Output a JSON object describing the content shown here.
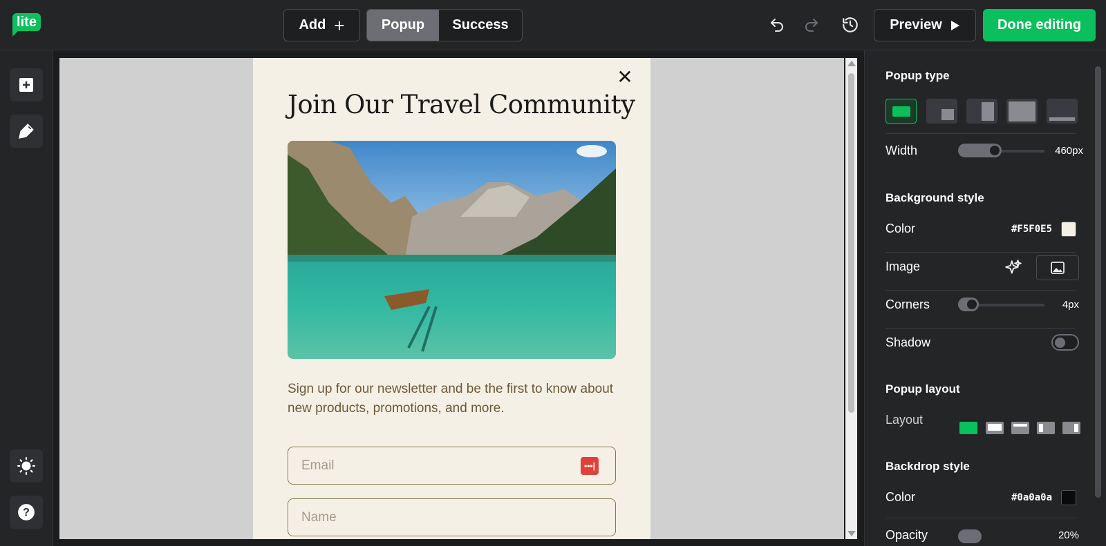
{
  "app": {
    "logo_text": "lite"
  },
  "toolbar": {
    "add_label": "Add",
    "add_icon": "plus-icon",
    "tabs": [
      {
        "label": "Popup",
        "active": true
      },
      {
        "label": "Success",
        "active": false
      }
    ],
    "undo_icon": "undo-icon",
    "redo_icon": "redo-icon",
    "history_icon": "history-icon",
    "preview_label": "Preview",
    "done_label": "Done editing"
  },
  "sidebar": {
    "items": [
      {
        "icon": "add-block-icon"
      },
      {
        "icon": "paint-brush-icon"
      },
      {
        "icon": "theme-sun-icon"
      },
      {
        "icon": "help-icon"
      }
    ]
  },
  "popup": {
    "close_icon": "close-icon",
    "title": "Join Our Travel Community",
    "description": "Sign up for our newsletter and be the first to know about new products, promotions, and more.",
    "email_placeholder": "Email",
    "name_placeholder": "Name",
    "background": "#F5F0E5"
  },
  "panel": {
    "popup_type_title": "Popup type",
    "width_label": "Width",
    "width_value": "460px",
    "width_fraction": 0.5,
    "background_style_title": "Background style",
    "color_label": "Color",
    "bg_color_hex": "#F5F0E5",
    "image_label": "Image",
    "corners_label": "Corners",
    "corners_value": "4px",
    "corners_fraction": 0.1,
    "shadow_label": "Shadow",
    "shadow_on": false,
    "popup_layout_title": "Popup layout",
    "layout_label": "Layout",
    "backdrop_style_title": "Backdrop style",
    "backdrop_color_label": "Color",
    "backdrop_color_hex": "#0a0a0a",
    "opacity_label": "Opacity",
    "opacity_value": "20%"
  },
  "colors": {
    "accent": "#0bbf5c",
    "panel_bg": "#242527"
  }
}
